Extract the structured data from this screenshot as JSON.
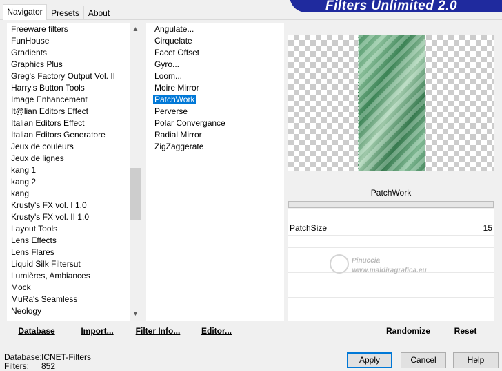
{
  "tabs": [
    "Navigator",
    "Presets",
    "About"
  ],
  "header": {
    "title": "Filters Unlimited 2.0"
  },
  "categories": [
    "Freeware filters",
    "FunHouse",
    "Gradients",
    "Graphics Plus",
    "Greg's Factory Output Vol. II",
    "Harry's Button Tools",
    "Image Enhancement",
    "It@lian Editors Effect",
    "Italian Editors Effect",
    "Italian Editors Generatore",
    "Jeux de couleurs",
    "Jeux de lignes",
    "kang 1",
    "kang 2",
    "kang",
    "Krusty's FX vol. I 1.0",
    "Krusty's FX vol. II 1.0",
    "Layout Tools",
    "Lens Effects",
    "Lens Flares",
    "Liquid Silk Filtersut",
    "Lumières, Ambiances",
    "Mock",
    "MuRa's Seamless",
    "Neology"
  ],
  "filters": [
    "Angulate...",
    "Cirquelate",
    "Facet Offset",
    "Gyro...",
    "Loom...",
    "Moire Mirror",
    "PatchWork",
    "Perverse",
    "Polar Convergance",
    "Radial Mirror",
    "ZigZaggerate"
  ],
  "selected_filter": "PatchWork",
  "icons": {
    "scroll_up": "▲",
    "scroll_down": "▼"
  },
  "preview": {
    "filter_name": "PatchWork"
  },
  "params": [
    {
      "label": "PatchSize",
      "value": "15"
    }
  ],
  "watermark": {
    "line1": "Pinuccia",
    "line2": "www.maldiragrafica.eu"
  },
  "left_bar": {
    "database": "Database",
    "import": "Import...",
    "filter_info": "Filter Info...",
    "editor": "Editor..."
  },
  "right_bar": {
    "randomize": "Randomize",
    "reset": "Reset"
  },
  "status": {
    "database_label": "Database:",
    "database_value": "ICNET-Filters",
    "filters_label": "Filters:",
    "filters_value": "852"
  },
  "buttons": {
    "apply": "Apply",
    "cancel": "Cancel",
    "help": "Help"
  }
}
